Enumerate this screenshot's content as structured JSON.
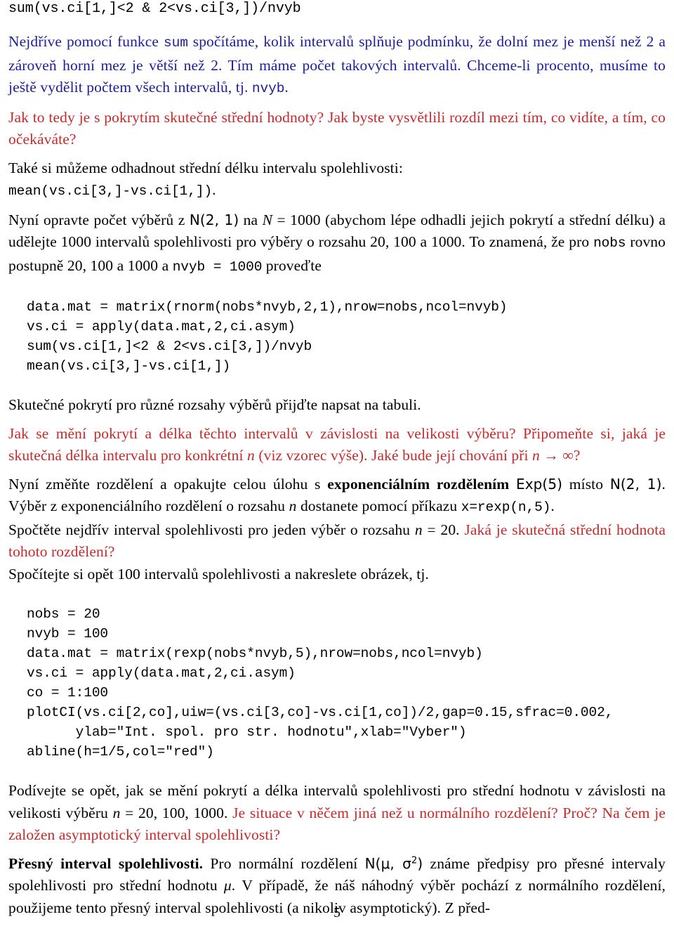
{
  "document": {
    "page_number": "5",
    "colors": {
      "body_black": "#000000",
      "body_blue": "#1d1d9e",
      "question_red": "#c62a2a",
      "background": "#ffffff"
    }
  },
  "top_code": {
    "line1": "sum(vs.ci[1,]<2 & 2<vs.ci[3,])/nvyb"
  },
  "p1": {
    "seg1": "Nejdříve pomocí funkce ",
    "code1": "sum",
    "seg2": " spočítáme, kolik intervalů splňuje podmínku, že dolní mez je menší než 2 a zároveň horní mez je větší než 2. Tím máme počet takových intervalů. Chceme-li procento, musíme to ještě vydělit počtem všech intervalů, tj. ",
    "code2": "nvyb",
    "seg3": "."
  },
  "p2": {
    "text": "Jak to tedy je s pokrytím skutečné střední hodnoty? Jak byste vysvětlili rozdíl mezi tím, co vidíte, a tím, co očekáváte?"
  },
  "p3": {
    "line1": "Také si můžeme odhadnout střední délku intervalu spolehlivosti:",
    "code1": "mean(vs.ci[3,]-vs.ci[1,])",
    "after_code": "."
  },
  "p4": {
    "seg1": "Nyní opravte počet výběrů z ",
    "math_dist": "N(2, 1)",
    "seg2": " na ",
    "math_n": "N",
    "seg3": " = 1000 (abychom lépe odhadli jejich pokrytí a střední délku) a udělejte 1000 intervalů spolehlivosti pro výběry o rozsahu 20, 100 a 1000. To znamená, že pro ",
    "code1": "nobs",
    "seg4": " rovno postupně 20, 100 a 1000 a  ",
    "code2": "nvyb = 1000",
    "seg5": " proveďte"
  },
  "code_block_1": {
    "lines": [
      "data.mat = matrix(rnorm(nobs*nvyb,2,1),nrow=nobs,ncol=nvyb)",
      "vs.ci = apply(data.mat,2,ci.asym)",
      "sum(vs.ci[1,]<2 & 2<vs.ci[3,])/nvyb",
      "mean(vs.ci[3,]-vs.ci[1,])"
    ]
  },
  "p5": {
    "text": "Skutečné pokrytí pro různé rozsahy výběrů přijďte napsat na tabuli."
  },
  "p6": {
    "seg1": "Jak se mění pokrytí a délka těchto intervalů v závislosti na velikosti výběru? Připomeňte si, jaká je skutečná délka intervalu pro konkrétní ",
    "math_n": "n",
    "seg2": " (viz vzorec výše). Jaké bude její chování při ",
    "math_limit": "n → ∞",
    "seg3": "?"
  },
  "p7": {
    "seg1": "Nyní změňte rozdělení a opakujte celou úlohu s ",
    "bold1": "exponenciálním rozdělením",
    "math_exp": "Exp(5)",
    "seg2": " místo ",
    "math_norm": "N(2, 1)",
    "seg3": ". Výběr z exponenciálního rozdělení o rozsahu ",
    "math_n": "n",
    "seg4": " dostanete pomocí příkazu ",
    "code1": "x=rexp(n,5)",
    "seg5": "."
  },
  "p8": {
    "seg1": "Spočtěte nejdřív interval spolehlivosti pro jeden výběr o rozsahu ",
    "math_n": "n",
    "seg2": " = 20. ",
    "red1": "Jaká je skutečná střední hodnota tohoto rozdělení?"
  },
  "p9": {
    "text": "Spočítejte si opět 100 intervalů spolehlivosti a nakreslete obrázek, tj."
  },
  "code_block_2": {
    "lines": [
      "nobs = 20",
      "nvyb = 100",
      "data.mat = matrix(rexp(nobs*nvyb,5),nrow=nobs,ncol=nvyb)",
      "vs.ci = apply(data.mat,2,ci.asym)",
      "co = 1:100",
      "plotCI(vs.ci[2,co],uiw=(vs.ci[3,co]-vs.ci[1,co])/2,gap=0.15,sfrac=0.002,",
      "      ylab=\"Int. spol. pro str. hodnotu\",xlab=\"Vyber\")",
      "abline(h=1/5,col=\"red\")"
    ]
  },
  "p10": {
    "seg1": "Podívejte se opět, jak se mění pokrytí a délka intervalů spolehlivosti pro střední hodnotu v závislosti na velikosti výběru ",
    "math_n": "n",
    "seg2": " = 20, 100, 1000. ",
    "red1": "Je situace v něčem jiná než u normálního rozdělení? Proč? Na čem je založen asymptotický interval spolehlivosti?"
  },
  "p11": {
    "bold_lead": "Přesný interval spolehlivosti.",
    "seg1": " Pro normální rozdělení ",
    "math_dist": "N(μ, σ",
    "math_dist_sup": "2",
    "math_dist_end": ")",
    "seg2": " známe předpisy pro přesné intervaly spolehlivosti pro střední hodnotu ",
    "math_mu": "μ",
    "seg3": ". V případě, že náš náhodný výběr pochází z normálního rozdělení, použijeme tento přesný interval spolehlivosti (a nikoliv asymptotický). Z před-"
  }
}
